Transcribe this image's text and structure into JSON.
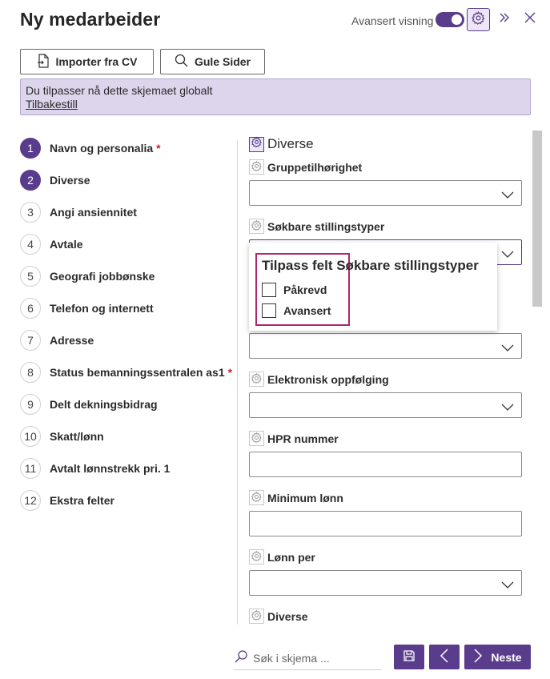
{
  "header": {
    "title": "Ny medarbeider",
    "advanced_label": "Avansert visning",
    "advanced_on": true
  },
  "actions": {
    "import_cv": "Importer fra CV",
    "gule_sider": "Gule Sider"
  },
  "banner": {
    "message": "Du tilpasser nå dette skjemaet globalt",
    "reset_link": "Tilbakestill"
  },
  "steps": [
    {
      "num": "1",
      "label": "Navn og personalia",
      "required": true,
      "active": true
    },
    {
      "num": "2",
      "label": "Diverse",
      "required": false,
      "active": true
    },
    {
      "num": "3",
      "label": "Angi ansiennitet",
      "required": false,
      "active": false
    },
    {
      "num": "4",
      "label": "Avtale",
      "required": false,
      "active": false
    },
    {
      "num": "5",
      "label": "Geografi jobbønske",
      "required": false,
      "active": false
    },
    {
      "num": "6",
      "label": "Telefon og internett",
      "required": false,
      "active": false
    },
    {
      "num": "7",
      "label": "Adresse",
      "required": false,
      "active": false
    },
    {
      "num": "8",
      "label": "Status bemanningssentralen as1",
      "required": true,
      "active": false
    },
    {
      "num": "9",
      "label": "Delt dekningsbidrag",
      "required": false,
      "active": false
    },
    {
      "num": "10",
      "label": "Skatt/lønn",
      "required": false,
      "active": false
    },
    {
      "num": "11",
      "label": "Avtalt lønnstrekk pri. 1",
      "required": false,
      "active": false
    },
    {
      "num": "12",
      "label": "Ekstra felter",
      "required": false,
      "active": false
    }
  ],
  "required_mark": "*",
  "form": {
    "section_title": "Diverse",
    "fields": {
      "gruppetilhorighet": "Gruppetilhørighet",
      "sokbare": "Søkbare stillingstyper",
      "elektronisk": "Elektronisk oppfølging",
      "hpr": "HPR nummer",
      "minimum": "Minimum lønn",
      "lonn_per": "Lønn per",
      "diverse": "Diverse"
    }
  },
  "popup": {
    "title": "Tilpass felt Søkbare stillingstyper",
    "options": [
      "Påkrevd",
      "Avansert"
    ]
  },
  "footer": {
    "search_placeholder": "Søk i skjema ...",
    "next_label": "Neste"
  },
  "colors": {
    "accent": "#5a3c8c",
    "banner_bg": "#ddd5ec",
    "highlight_border": "#b0266b",
    "required": "#c0272d"
  }
}
